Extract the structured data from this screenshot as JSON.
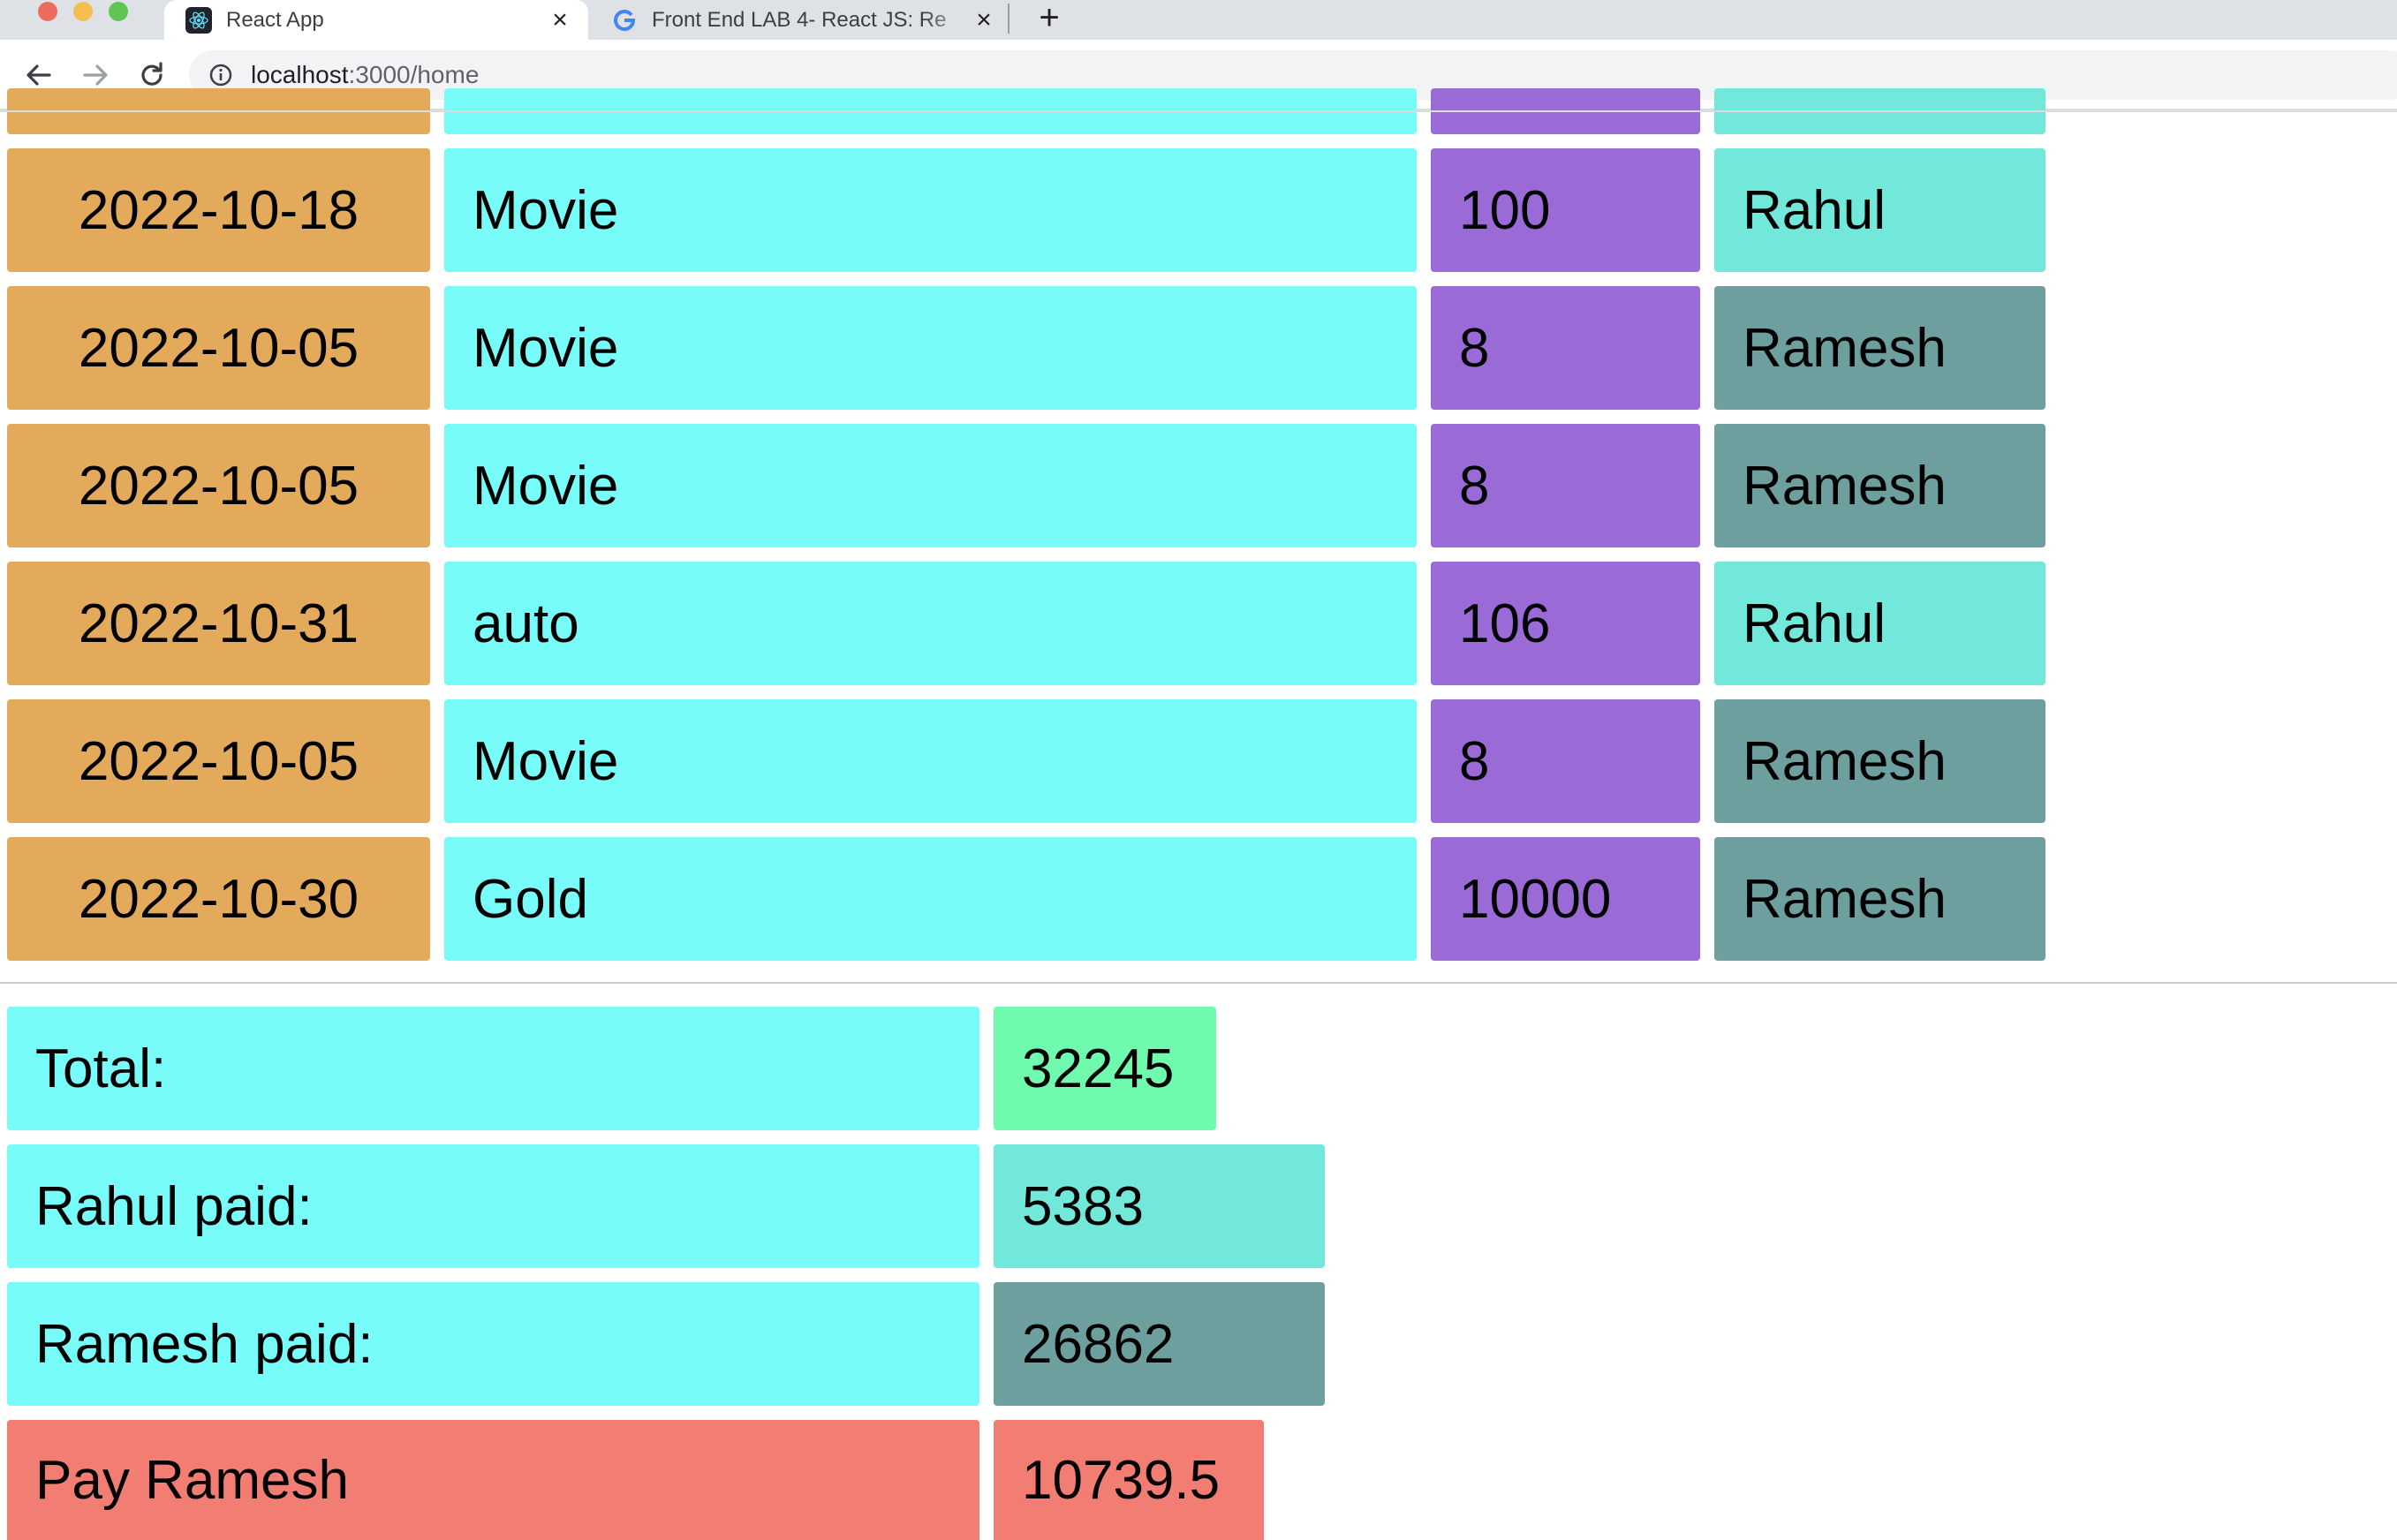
{
  "browser": {
    "tabs": [
      {
        "title": "React App",
        "icon": "react-favicon-icon",
        "active": true
      },
      {
        "title": "Front End LAB 4- React JS: Re",
        "icon": "google-favicon-icon",
        "active": false
      }
    ],
    "address": {
      "host": "localhost",
      "path": ":3000/home"
    }
  },
  "expenses": [
    {
      "date": "2022-10-18",
      "product": "Movie",
      "price": "100",
      "payee": "Rahul"
    },
    {
      "date": "2022-10-05",
      "product": "Movie",
      "price": "8",
      "payee": "Ramesh"
    },
    {
      "date": "2022-10-05",
      "product": "Movie",
      "price": "8",
      "payee": "Ramesh"
    },
    {
      "date": "2022-10-31",
      "product": "auto",
      "price": "106",
      "payee": "Rahul"
    },
    {
      "date": "2022-10-05",
      "product": "Movie",
      "price": "8",
      "payee": "Ramesh"
    },
    {
      "date": "2022-10-30",
      "product": "Gold",
      "price": "10000",
      "payee": "Ramesh"
    }
  ],
  "summary": {
    "total_label": "Total:",
    "total_value": "32245",
    "rahul_label": "Rahul paid:",
    "rahul_value": "5383",
    "ramesh_label": "Ramesh paid:",
    "ramesh_value": "26862",
    "pay_label": "Pay Ramesh",
    "pay_value": "10739.5"
  },
  "colors": {
    "date_cell": "#e4aa5c",
    "product_cell": "#77fcfa",
    "price_cell": "#9a6ad7",
    "rahul_cell": "#71e8da",
    "ramesh_cell": "#6e9f9f",
    "total_value_cell": "#6ffaae",
    "pay_cell": "#f27d72"
  }
}
